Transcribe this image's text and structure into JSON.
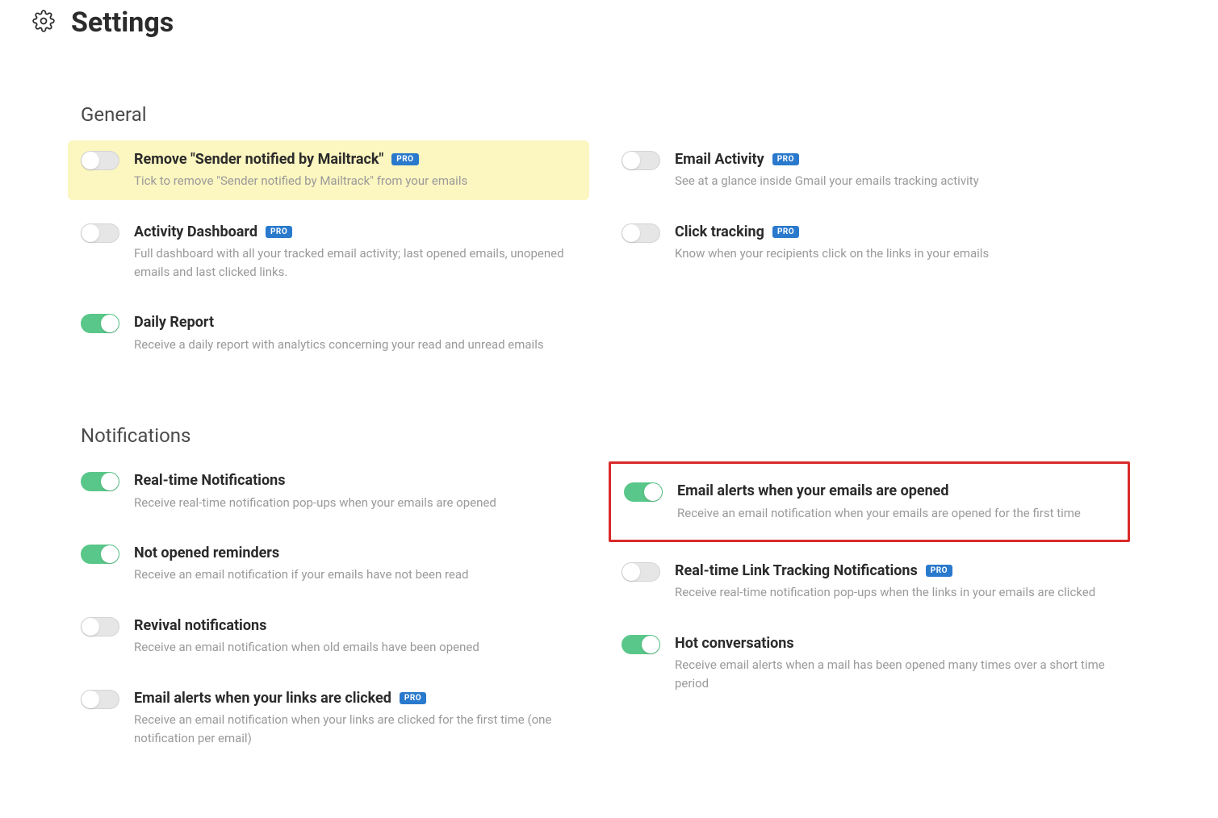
{
  "page": {
    "title": "Settings"
  },
  "badges": {
    "pro": "PRO"
  },
  "sections": {
    "general": {
      "title": "General",
      "left": [
        {
          "id": "remove-signature",
          "title": "Remove \"Sender notified by Mailtrack\"",
          "desc": "Tick to remove \"Sender notified by Mailtrack\" from your emails",
          "on": false,
          "pro": true,
          "highlight": "yellow"
        },
        {
          "id": "activity-dashboard",
          "title": "Activity Dashboard",
          "desc": "Full dashboard with all your tracked email activity; last opened emails, unopened emails and last clicked links.",
          "on": false,
          "pro": true
        },
        {
          "id": "daily-report",
          "title": "Daily Report",
          "desc": "Receive a daily report with analytics concerning your read and unread emails",
          "on": true,
          "pro": false
        }
      ],
      "right": [
        {
          "id": "email-activity",
          "title": "Email Activity",
          "desc": "See at a glance inside Gmail your emails tracking activity",
          "on": false,
          "pro": true
        },
        {
          "id": "click-tracking",
          "title": "Click tracking",
          "desc": "Know when your recipients click on the links in your emails",
          "on": false,
          "pro": true
        }
      ]
    },
    "notifications": {
      "title": "Notifications",
      "left": [
        {
          "id": "realtime-notifications",
          "title": "Real-time Notifications",
          "desc": "Receive real-time notification pop-ups when your emails are opened",
          "on": true,
          "pro": false
        },
        {
          "id": "not-opened-reminders",
          "title": "Not opened reminders",
          "desc": "Receive an email notification if your emails have not been read",
          "on": true,
          "pro": false
        },
        {
          "id": "revival-notifications",
          "title": "Revival notifications",
          "desc": "Receive an email notification when old emails have been opened",
          "on": false,
          "pro": false
        },
        {
          "id": "email-alerts-links",
          "title": "Email alerts when your links are clicked",
          "desc": "Receive an email notification when your links are clicked for the first time (one notification per email)",
          "on": false,
          "pro": true
        }
      ],
      "right": [
        {
          "id": "email-alerts-opened",
          "title": "Email alerts when your emails are opened",
          "desc": "Receive an email notification when your emails are opened for the first time",
          "on": true,
          "pro": false,
          "highlight": "red"
        },
        {
          "id": "realtime-link-tracking",
          "title": "Real-time Link Tracking Notifications",
          "desc": "Receive real-time notification pop-ups when the links in your emails are clicked",
          "on": false,
          "pro": true
        },
        {
          "id": "hot-conversations",
          "title": "Hot conversations",
          "desc": "Receive email alerts when a mail has been opened many times over a short time period",
          "on": true,
          "pro": false
        }
      ]
    }
  }
}
